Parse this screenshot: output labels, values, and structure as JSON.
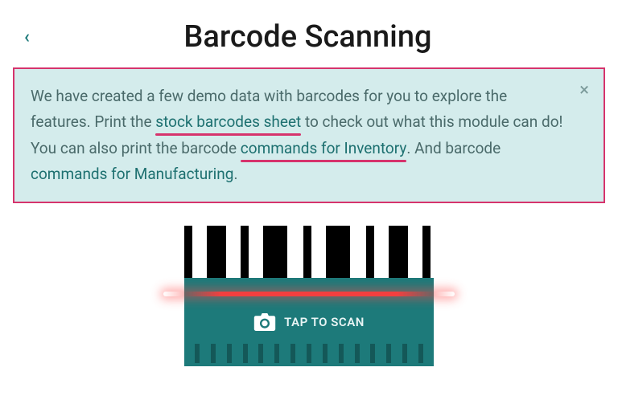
{
  "header": {
    "title": "Barcode Scanning",
    "back_glyph": "‹"
  },
  "alert": {
    "text_pre_link1": "We have created a few demo data with barcodes for you to explore the features. Print the ",
    "link1": "stock barcodes sheet",
    "text_mid_1": " to check out what this module can do! You can also print the barcode ",
    "link2": "commands for Inventory",
    "text_mid_2": ". And barcode ",
    "link3": "commands for Manufacturing",
    "text_post": ".",
    "close_glyph": "×"
  },
  "scan": {
    "label": "TAP TO SCAN"
  }
}
